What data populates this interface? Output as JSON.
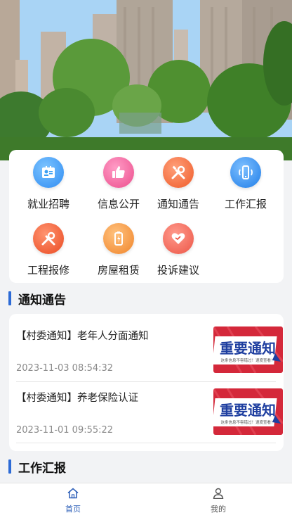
{
  "grid": [
    {
      "label": "就业招聘",
      "icon": "id-card-icon",
      "color": "#3b9ff3"
    },
    {
      "label": "信息公开",
      "icon": "thumbs-up-icon",
      "color": "#f0609a"
    },
    {
      "label": "通知通告",
      "icon": "tools-icon",
      "color": "#f5703a"
    },
    {
      "label": "工作汇报",
      "icon": "phone-icon",
      "color": "#2f8cf2"
    },
    {
      "label": "工程报修",
      "icon": "wrench-icon",
      "color": "#f55d34"
    },
    {
      "label": "房屋租赁",
      "icon": "battery-icon",
      "color": "#f59a3c"
    },
    {
      "label": "投诉建议",
      "icon": "handshake-heart-icon",
      "color": "#f26b5e"
    }
  ],
  "sections": {
    "notices_title": "通知通告",
    "reports_title": "工作汇报"
  },
  "notices": [
    {
      "title": "【村委通知】老年人分面通知",
      "time": "2023-11-03 08:54:32",
      "thumb_text": "重要通知",
      "thumb_sub": "这条信息不容错过！速度查看！"
    },
    {
      "title": "【村委通知】养老保险认证",
      "time": "2023-11-01 09:55:22",
      "thumb_text": "重要通知",
      "thumb_sub": "这条信息不容错过！速度查看！"
    }
  ],
  "tabs": [
    {
      "label": "首页",
      "icon": "home-icon",
      "active": true
    },
    {
      "label": "我的",
      "icon": "user-icon",
      "active": false
    }
  ],
  "colors": {
    "accent": "#2d6bd6",
    "tab_active": "#2d5fb8",
    "tab_inactive": "#555555"
  }
}
